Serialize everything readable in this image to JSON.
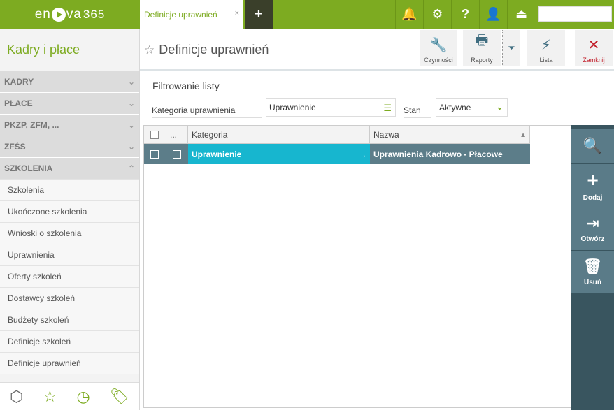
{
  "app": {
    "logo_pre": "en",
    "logo_post": "va",
    "logo_num": "365"
  },
  "tabs": [
    {
      "label": "Definicje uprawnień",
      "close": "×"
    }
  ],
  "tab_add": "+",
  "top_icons": [
    "bell-icon",
    "gear-icon",
    "help-icon",
    "user-icon",
    "logout-icon"
  ],
  "top_glyphs": {
    "bell": "🔔",
    "gear": "⚙",
    "help": "?",
    "user": "👤",
    "logout": "⏏"
  },
  "sidebar": {
    "title": "Kadry i płace",
    "sections": [
      {
        "label": "KADRY",
        "chevron": "⌄"
      },
      {
        "label": "PŁACE",
        "chevron": "⌄"
      },
      {
        "label": "PKZP, ZFM, ...",
        "chevron": "⌄"
      },
      {
        "label": "ZFŚS",
        "chevron": "⌄"
      },
      {
        "label": "SZKOLENIA",
        "chevron": "⌃"
      }
    ],
    "items": [
      "Szkolenia",
      "Ukończone szkolenia",
      "Wnioski o szkolenia",
      "Uprawnienia",
      "Oferty szkoleń",
      "Dostawcy szkoleń",
      "Budżety szkoleń",
      "Definicje szkoleń",
      "Definicje uprawnień"
    ],
    "bottom": {
      "box": "⬡",
      "star": "☆",
      "clock": "◷",
      "tag": "🏷"
    }
  },
  "header": {
    "star": "☆",
    "title": "Definicje uprawnień",
    "toolbar": {
      "czynnosci": {
        "label": "Czynności",
        "glyph": "🔧"
      },
      "raporty": {
        "label": "Raporty",
        "glyph": "🖶"
      },
      "dropdown": "⏷",
      "lista": {
        "label": "Lista",
        "glyph": "⚡"
      },
      "zamknij": {
        "label": "Zamknij",
        "glyph": "✕"
      }
    }
  },
  "filter": {
    "title": "Filtrowanie listy",
    "kategoria_label": "Kategoria uprawnienia",
    "kategoria_value": "Uprawnienie",
    "list_glyph": "☰",
    "stan_label": "Stan",
    "stan_value": "Aktywne",
    "stan_glyph": "⌄"
  },
  "grid": {
    "headers": {
      "dots": "...",
      "kategoria": "Kategoria",
      "nazwa": "Nazwa",
      "sort": "▲"
    },
    "rows": [
      {
        "kategoria": "Uprawnienie",
        "arrow": "→",
        "nazwa": "Uprawnienia Kadrowo - Płacowe"
      }
    ]
  },
  "actions": {
    "search": {
      "glyph": "🔍"
    },
    "dodaj": {
      "label": "Dodaj",
      "glyph": "+"
    },
    "otworz": {
      "label": "Otwórz",
      "glyph": "⇥"
    },
    "usun": {
      "label": "Usuń",
      "glyph": "🗑"
    }
  },
  "colors": {
    "brand": "#7dab21",
    "selected_row": "#17b6cf",
    "selected_row_alt": "#5c7d89",
    "action_bar": "#39555f",
    "close": "#c21f2b"
  }
}
